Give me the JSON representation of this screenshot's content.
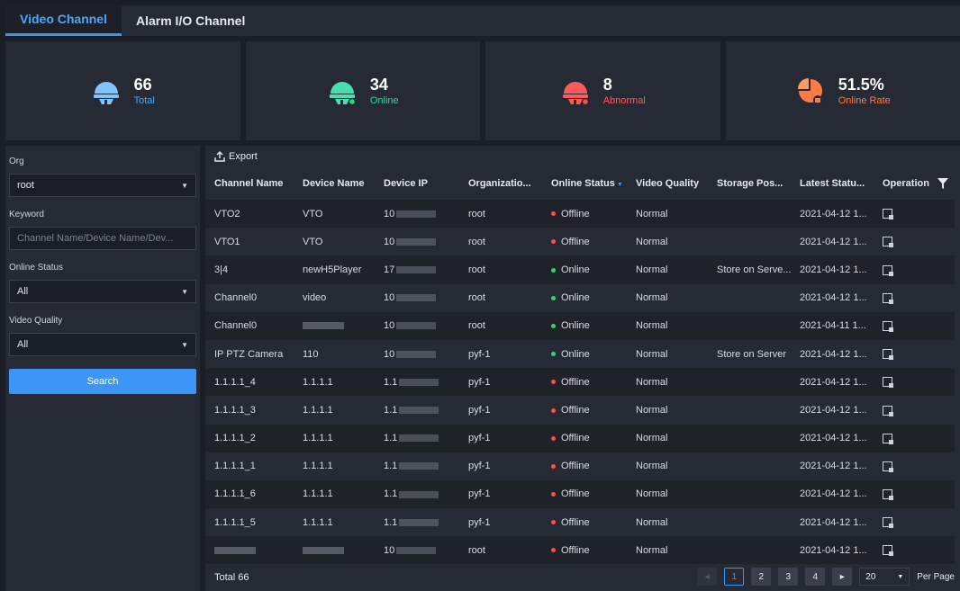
{
  "tabs": [
    {
      "label": "Video Channel",
      "active": true
    },
    {
      "label": "Alarm I/O Channel",
      "active": false
    }
  ],
  "stats": [
    {
      "value": "66",
      "label": "Total",
      "color": "#4aa8ff",
      "icon": "camera-total-icon"
    },
    {
      "value": "34",
      "label": "Online",
      "color": "#32d6a0",
      "icon": "camera-online-icon"
    },
    {
      "value": "8",
      "label": "Abnormal",
      "color": "#ff5b5b",
      "icon": "camera-abnormal-icon"
    },
    {
      "value": "51.5%",
      "label": "Online Rate",
      "color": "#ff7a45",
      "icon": "pie-rate-icon"
    }
  ],
  "filters": {
    "org_label": "Org",
    "org_value": "root",
    "keyword_label": "Keyword",
    "keyword_placeholder": "Channel Name/Device Name/Dev...",
    "status_label": "Online Status",
    "status_value": "All",
    "quality_label": "Video Quality",
    "quality_value": "All",
    "search_label": "Search"
  },
  "toolbar": {
    "export_label": "Export"
  },
  "columns": [
    "Channel Name",
    "Device Name",
    "Device IP",
    "Organizatio...",
    "Online Status",
    "Video Quality",
    "Storage Pos...",
    "Latest Statu...",
    "Operation"
  ],
  "rows": [
    {
      "channel": "VTO2",
      "device": "VTO",
      "ip": "10",
      "org": "root",
      "status": "Offline",
      "quality": "Normal",
      "storage": "",
      "latest": "2021-04-12 1..."
    },
    {
      "channel": "VTO1",
      "device": "VTO",
      "ip": "10",
      "org": "root",
      "status": "Offline",
      "quality": "Normal",
      "storage": "",
      "latest": "2021-04-12 1..."
    },
    {
      "channel": "3|4",
      "device": "newH5Player",
      "ip": "17",
      "org": "root",
      "status": "Online",
      "quality": "Normal",
      "storage": "Store on Serve...",
      "latest": "2021-04-12 1..."
    },
    {
      "channel": "Channel0",
      "device": "video",
      "ip": "10",
      "org": "root",
      "status": "Online",
      "quality": "Normal",
      "storage": "",
      "latest": "2021-04-12 1..."
    },
    {
      "channel": "Channel0",
      "device": "",
      "ip": "10",
      "org": "root",
      "status": "Online",
      "quality": "Normal",
      "storage": "",
      "latest": "2021-04-11 1..."
    },
    {
      "channel": "IP PTZ Camera",
      "device": "110",
      "ip": "10",
      "org": "pyf-1",
      "status": "Online",
      "quality": "Normal",
      "storage": "Store on Server",
      "latest": "2021-04-12 1..."
    },
    {
      "channel": "1.1.1.1_4",
      "device": "1.1.1.1",
      "ip": "1.1",
      "org": "pyf-1",
      "status": "Offline",
      "quality": "Normal",
      "storage": "",
      "latest": "2021-04-12 1..."
    },
    {
      "channel": "1.1.1.1_3",
      "device": "1.1.1.1",
      "ip": "1.1",
      "org": "pyf-1",
      "status": "Offline",
      "quality": "Normal",
      "storage": "",
      "latest": "2021-04-12 1..."
    },
    {
      "channel": "1.1.1.1_2",
      "device": "1.1.1.1",
      "ip": "1.1",
      "org": "pyf-1",
      "status": "Offline",
      "quality": "Normal",
      "storage": "",
      "latest": "2021-04-12 1..."
    },
    {
      "channel": "1.1.1.1_1",
      "device": "1.1.1.1",
      "ip": "1.1",
      "org": "pyf-1",
      "status": "Offline",
      "quality": "Normal",
      "storage": "",
      "latest": "2021-04-12 1..."
    },
    {
      "channel": "1.1.1.1_6",
      "device": "1.1.1.1",
      "ip": "1.1",
      "org": "pyf-1",
      "status": "Offline",
      "quality": "Normal",
      "storage": "",
      "latest": "2021-04-12 1..."
    },
    {
      "channel": "1.1.1.1_5",
      "device": "1.1.1.1",
      "ip": "1.1",
      "org": "pyf-1",
      "status": "Offline",
      "quality": "Normal",
      "storage": "",
      "latest": "2021-04-12 1..."
    },
    {
      "channel": "",
      "device": "",
      "ip": "10",
      "org": "root",
      "status": "Offline",
      "quality": "Normal",
      "storage": "",
      "latest": "2021-04-12 1..."
    }
  ],
  "status_colors": {
    "Online": "#32d67a",
    "Offline": "#ff4d4f"
  },
  "footer": {
    "total": "Total 66",
    "pages": [
      "1",
      "2",
      "3",
      "4"
    ],
    "current_page": "1",
    "per_page_value": "20",
    "per_page_label": "Per Page"
  }
}
